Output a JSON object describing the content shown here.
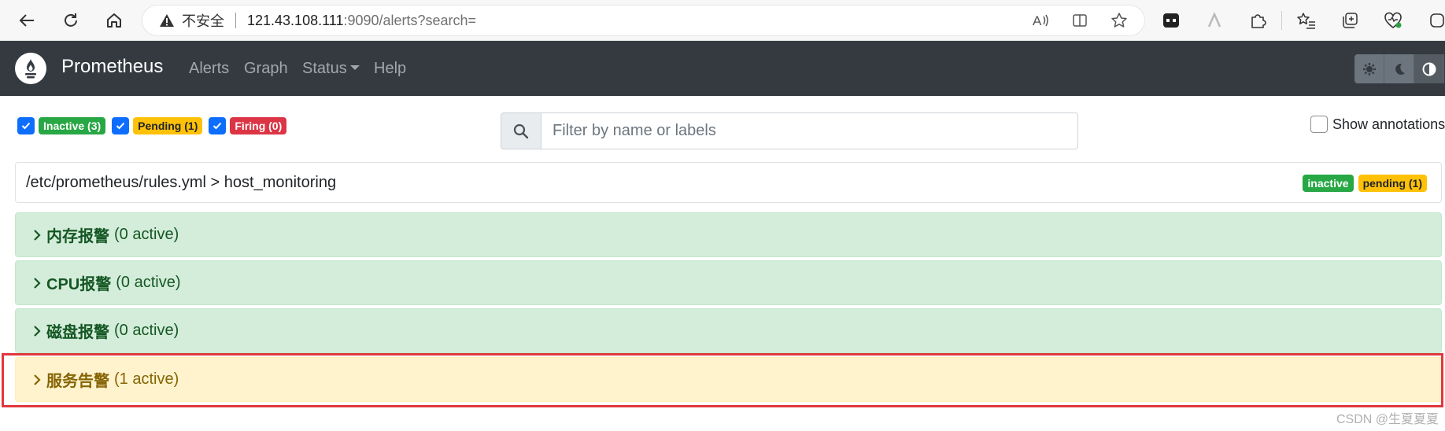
{
  "browser": {
    "security_label": "不安全",
    "url_host": "121.43.108.111",
    "url_path": ":9090/alerts?search="
  },
  "navbar": {
    "brand": "Prometheus",
    "links": [
      "Alerts",
      "Graph",
      "Status",
      "Help"
    ]
  },
  "filters": {
    "inactive": "Inactive (3)",
    "pending": "Pending (1)",
    "firing": "Firing (0)",
    "search_placeholder": "Filter by name or labels",
    "show_annotations": "Show annotations"
  },
  "group": {
    "title": "/etc/prometheus/rules.yml > host_monitoring",
    "badges": [
      "inactive",
      "pending (1)"
    ]
  },
  "alerts": [
    {
      "name": "内存报警",
      "count": "(0 active)",
      "state": "inactive"
    },
    {
      "name": "CPU报警",
      "count": "(0 active)",
      "state": "inactive"
    },
    {
      "name": "磁盘报警",
      "count": "(0 active)",
      "state": "inactive"
    },
    {
      "name": "服务告警",
      "count": "(1 active)",
      "state": "pending"
    }
  ],
  "watermark": "CSDN @生夏夏夏",
  "colors": {
    "navbar": "#343a40",
    "inactive_bg": "#d4edda",
    "pending_bg": "#fff3cd",
    "highlight": "#e0383d"
  }
}
